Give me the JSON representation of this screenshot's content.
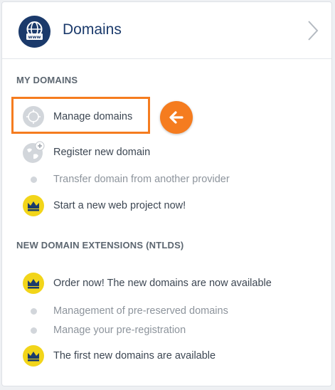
{
  "header": {
    "title": "Domains",
    "icon": "globe-www-icon",
    "chevron": "chevron-right-icon"
  },
  "sections": [
    {
      "title": "MY DOMAINS",
      "items": [
        {
          "label": "Manage domains",
          "icon": "globe-cursor-icon",
          "highlighted": true
        },
        {
          "label": "Register new domain",
          "icon": "globe-add-icon"
        },
        {
          "label": "Transfer domain from another provider",
          "icon": "bullet-dot",
          "muted": true
        },
        {
          "label": "Start a new web project now!",
          "icon": "crown-badge-icon"
        }
      ]
    },
    {
      "title": "NEW DOMAIN EXTENSIONS (NTLDS)",
      "items": [
        {
          "label": "Order now! The new domains are now available",
          "icon": "crown-badge-icon"
        },
        {
          "label": "Management of pre-reserved domains",
          "icon": "bullet-dot",
          "muted": true
        },
        {
          "label": "Manage your pre-registration",
          "icon": "bullet-dot",
          "muted": true
        },
        {
          "label": "The first new domains are available",
          "icon": "crown-badge-icon"
        }
      ]
    }
  ],
  "annotation": {
    "icon": "arrow-left-icon",
    "color": "#f57c1f"
  },
  "colors": {
    "brand": "#1b3a6b",
    "crown_badge": "#f2d51a",
    "highlight": "#f57c1f"
  }
}
